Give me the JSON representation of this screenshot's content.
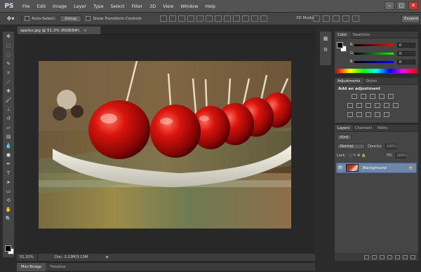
{
  "app": {
    "logo": "PS"
  },
  "menu": [
    "File",
    "Edit",
    "Image",
    "Layer",
    "Type",
    "Select",
    "Filter",
    "3D",
    "View",
    "Window",
    "Help"
  ],
  "window_controls": {
    "minimize": "–",
    "maximize": "□",
    "close": "✕"
  },
  "options": {
    "tool_icon": "move-tool-icon",
    "auto_select_label": "Auto-Select:",
    "auto_select_mode": "Group",
    "show_transform_label": "Show Transform Controls",
    "mode_label": "3D Mode:",
    "workspace": "Essentials"
  },
  "document": {
    "tab_title": "apples.jpg @ 51.3% (RGB/8#)",
    "tab_close": "×",
    "zoom": "51.32%",
    "doc_size": "Doc: 3.13M/3.13M",
    "status_arrow": "▶"
  },
  "bottom_tabs": [
    "Mini Bridge",
    "Timeline"
  ],
  "color_panel": {
    "tabs": [
      "Color",
      "Swatches"
    ],
    "channels": [
      {
        "label": "R",
        "value": "0"
      },
      {
        "label": "G",
        "value": "0"
      },
      {
        "label": "B",
        "value": "0"
      }
    ]
  },
  "adjustments_panel": {
    "tabs": [
      "Adjustments",
      "Styles"
    ],
    "title": "Add an adjustment"
  },
  "layers_panel": {
    "tabs": [
      "Layers",
      "Channels",
      "Paths"
    ],
    "kind_filter": "Kind",
    "blend_mode": "Normal",
    "opacity_label": "Opacity:",
    "opacity_value": "100%",
    "lock_label": "Lock:",
    "fill_label": "Fill:",
    "fill_value": "100%",
    "layer_name": "Background",
    "eye_icon": "👁",
    "lock_icon": "🔒"
  },
  "colors": {
    "menubar": "#535353",
    "panel": "#454545",
    "selected_layer": "#6c85a8",
    "apple_red": "#c0150f"
  }
}
